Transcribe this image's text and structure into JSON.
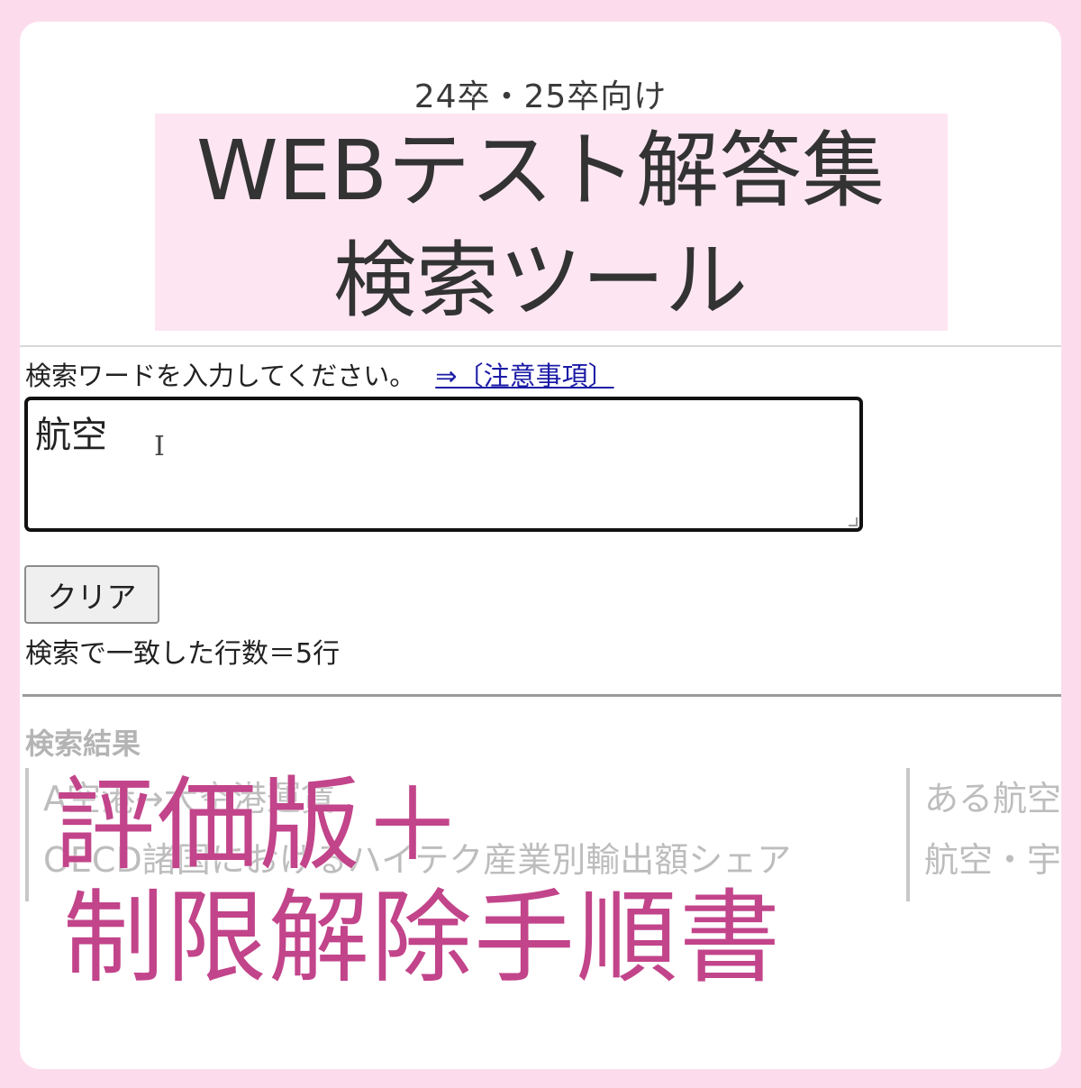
{
  "header": {
    "subtitle": "24卒・25卒向け",
    "title_line1": "WEBテスト解答集",
    "title_line2": "検索ツール"
  },
  "search": {
    "prompt": "検索ワードを入力してください。",
    "notice_link": "⇒〔注意事項〕",
    "value": "航空",
    "cursor_glyph": "I"
  },
  "controls": {
    "clear_label": "クリア",
    "match_count": "検索で一致した行数＝5行"
  },
  "results": {
    "heading": "検索結果",
    "column1": [
      "A空港→大空港運賃",
      "OECD諸国におけるハイテク産業別輸出額シェア"
    ],
    "column2": [
      "ある航空",
      "航空・宇"
    ]
  },
  "overlay": {
    "line1": "評価版＋",
    "line2": "制限解除手順書"
  },
  "colors": {
    "background": "#fcdcec",
    "title_band": "#fde6f2",
    "overlay_text": "#c2448a",
    "link": "#1a1aa6"
  }
}
